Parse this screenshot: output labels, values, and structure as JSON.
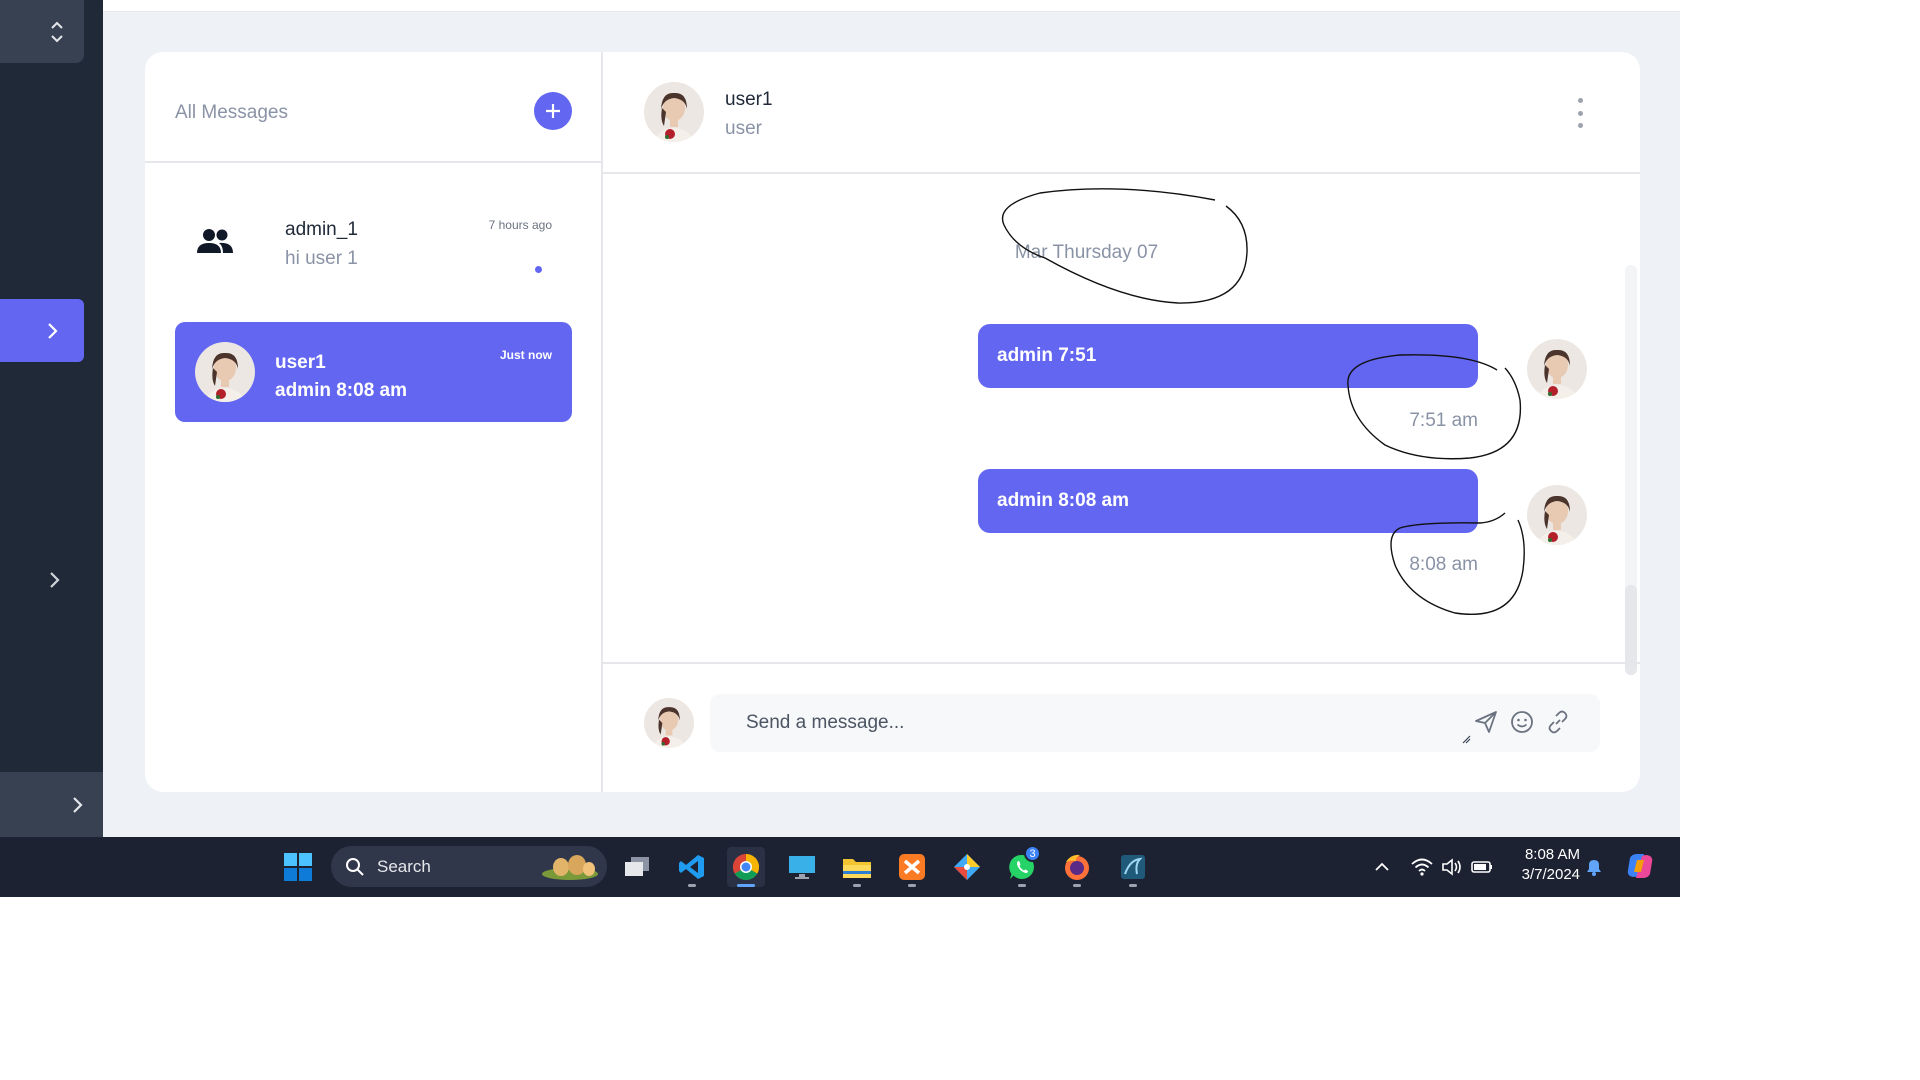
{
  "sidebar": {
    "top_icon": "sort-arrows-icon",
    "active_icon": "chevron-right-icon",
    "middle_icon": "chevron-right-icon",
    "bottom_icon": "chevron-right-icon"
  },
  "list": {
    "title": "All Messages",
    "add_icon": "plus-icon",
    "conversations": [
      {
        "name": "admin_1",
        "preview": "hi user 1",
        "time": "7 hours ago",
        "icon": "group-icon",
        "unread": true
      },
      {
        "name": "user1",
        "preview": "admin 8:08 am",
        "time": "Just now",
        "icon": "avatar",
        "selected": true
      }
    ]
  },
  "chat": {
    "header": {
      "name": "user1",
      "role": "user",
      "menu_icon": "kebab-menu-icon"
    },
    "date_separator": "Mar Thursday 07",
    "messages": [
      {
        "text": "admin 7:51",
        "time": "7:51 am"
      },
      {
        "text": "admin 8:08 am",
        "time": "8:08 am"
      }
    ],
    "composer": {
      "placeholder": "Send a message...",
      "icons": [
        "send-icon",
        "emoji-icon",
        "link-icon"
      ]
    }
  },
  "taskbar": {
    "search_label": "Search",
    "apps": [
      "task-view-icon",
      "vscode-icon",
      "chrome-icon",
      "remote-desktop-icon",
      "file-explorer-icon",
      "xampp-icon",
      "git-icon",
      "whatsapp-icon",
      "firefox-icon",
      "mysql-workbench-icon"
    ],
    "whatsapp_badge": "3",
    "clock_time": "8:08 AM",
    "clock_date": "3/7/2024"
  },
  "colors": {
    "accent": "#6366f1",
    "sidebar": "#1f2937",
    "taskbar": "#1d2232"
  }
}
